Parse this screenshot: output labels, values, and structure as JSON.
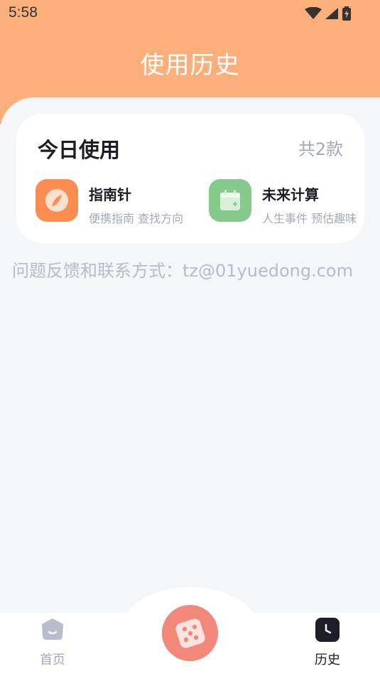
{
  "status_bar": {
    "time": "5:58"
  },
  "header": {
    "title": "使用历史"
  },
  "today_card": {
    "title": "今日使用",
    "count": "共2款",
    "apps": [
      {
        "name": "指南针",
        "desc": "便携指南 查找方向",
        "icon": "compass-icon",
        "color": "#fb8d50"
      },
      {
        "name": "未来计算",
        "desc": "人生事件 预估趣味",
        "icon": "calendar-icon",
        "color": "#85c98c"
      }
    ]
  },
  "feedback": {
    "text": "问题反馈和联系方式：tz@01yuedong.com"
  },
  "tabbar": {
    "home_label": "首页",
    "history_label": "历史",
    "center_icon": "dice-icon",
    "center_color": "#f2887a"
  }
}
